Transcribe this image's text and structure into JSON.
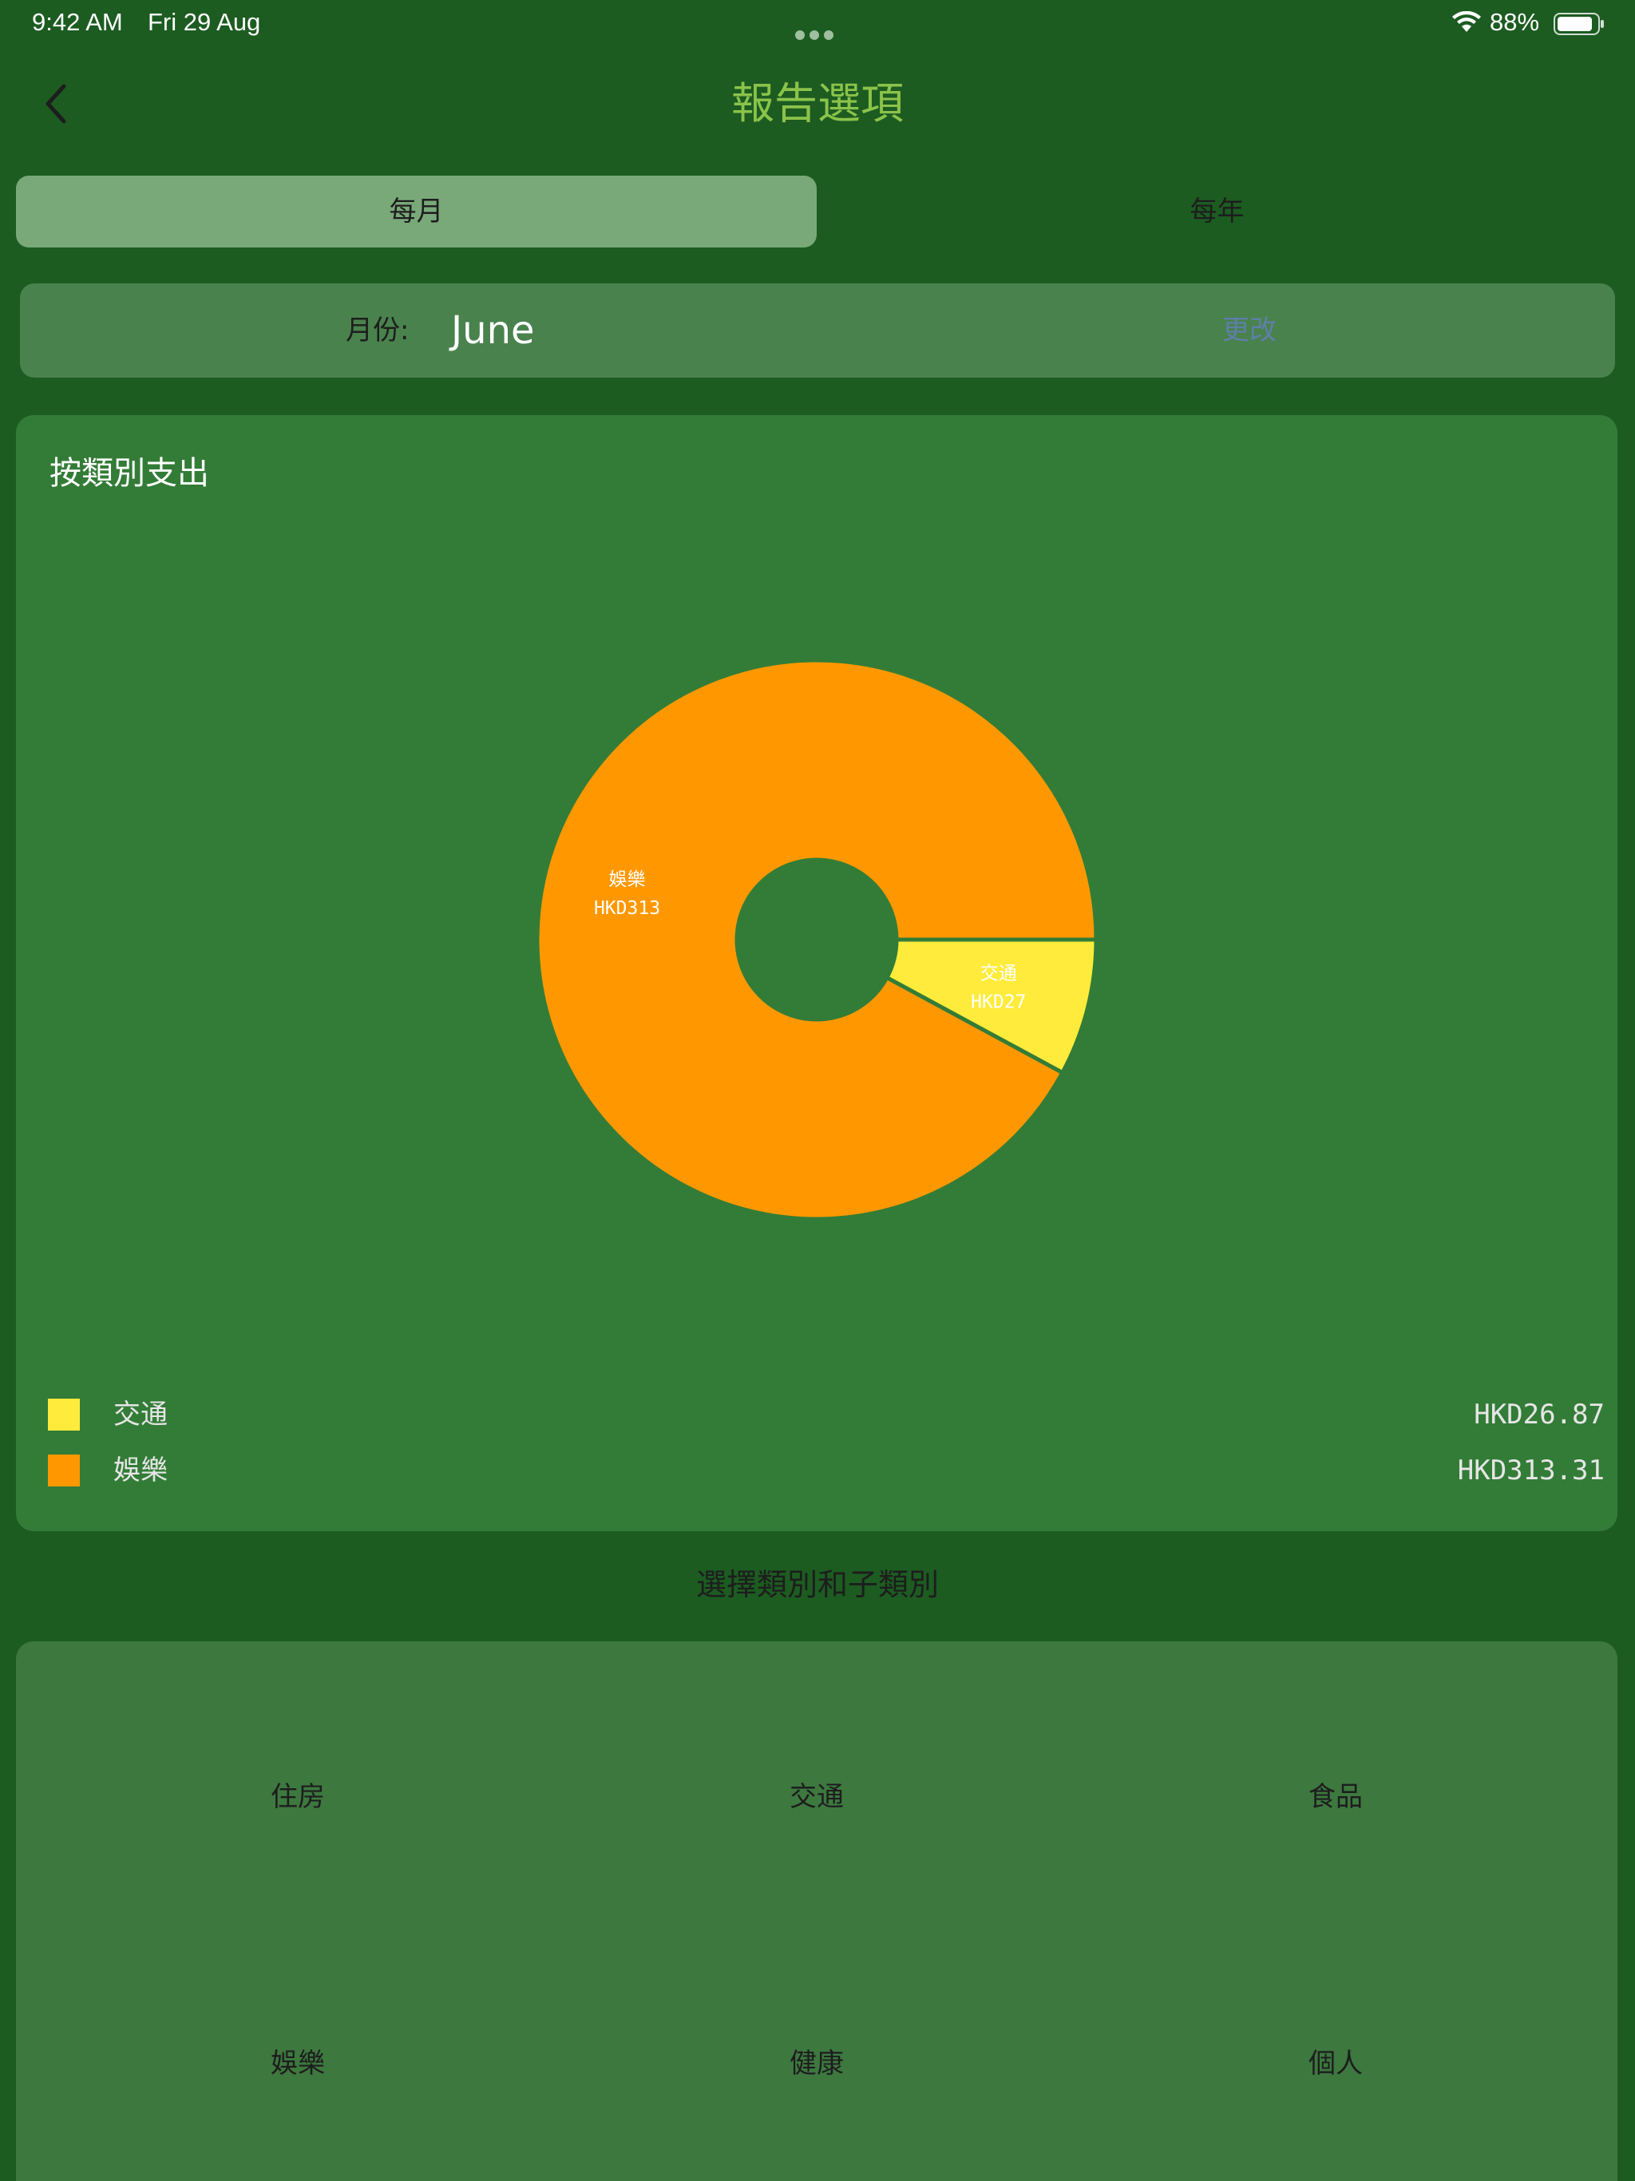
{
  "status_bar": {
    "time": "9:42 AM",
    "date": "Fri 29 Aug",
    "battery": "88%"
  },
  "nav": {
    "title": "報告選項",
    "back_icon": "chevron-left-icon"
  },
  "segments": {
    "monthly": "每月",
    "yearly": "每年",
    "selected": "monthly"
  },
  "month": {
    "label": "月份:",
    "value": "June",
    "change": "更改"
  },
  "chart_card": {
    "title": "按類別支出"
  },
  "chart_data": {
    "type": "pie",
    "donut": true,
    "slices": [
      {
        "name": "交通",
        "value": 26.87,
        "label_line1": "交通",
        "label_line2": "HKD27",
        "color": "#ffeb3b"
      },
      {
        "name": "娛樂",
        "value": 313.31,
        "label_line1": "娛樂",
        "label_line2": "HKD313",
        "color": "#ff9800"
      }
    ],
    "legend": [
      {
        "name": "交通",
        "amount": "HKD26.87",
        "color": "#ffeb3b"
      },
      {
        "name": "娛樂",
        "amount": "HKD313.31",
        "color": "#ff9800"
      }
    ]
  },
  "section": {
    "heading": "選擇類別和子類別"
  },
  "categories": [
    "住房",
    "交通",
    "食品",
    "娛樂",
    "健康",
    "個人"
  ],
  "colors": {
    "background": "#1c5c21",
    "title": "#8bc34a",
    "card": "#337c37"
  }
}
